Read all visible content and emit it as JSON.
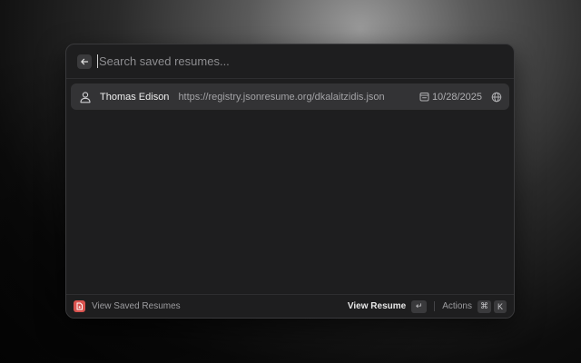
{
  "search": {
    "placeholder": "Search saved resumes...",
    "value": ""
  },
  "list": {
    "items": [
      {
        "icon": "person-icon",
        "title": "Thomas Edison",
        "subtitle": "https://registry.jsonresume.org/dkalaitzidis.json",
        "date": "10/28/2025",
        "date_icon": "calendar-icon",
        "trailing_icon": "globe-icon"
      }
    ]
  },
  "footer": {
    "app_icon": "resume-app-icon",
    "title": "View Saved Resumes",
    "primary_action": "View Resume",
    "primary_shortcut": "↵",
    "actions_label": "Actions",
    "actions_shortcut_mod": "⌘",
    "actions_shortcut_key": "K"
  },
  "colors": {
    "window_bg": "#1e1e1f",
    "selected_row": "#333335",
    "app_icon_bg": "#d9534f",
    "text_primary": "#efefef",
    "text_secondary": "#a3a3a6"
  }
}
